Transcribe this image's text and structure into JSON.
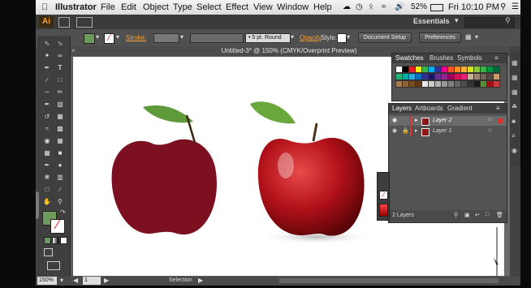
{
  "menubar": {
    "apple": "",
    "app_name": "Illustrator",
    "items": [
      "File",
      "Edit",
      "Object",
      "Type",
      "Select",
      "Effect",
      "View",
      "Window",
      "Help"
    ],
    "battery": "52%",
    "clock": "Fri 10:10 PM"
  },
  "appbar": {
    "logo": "Ai",
    "workspace": "Essentials"
  },
  "controlbar": {
    "stroke_label": "Stroke:",
    "brush": "5 pt. Round",
    "opacity_label": "Opacity",
    "style_label": "Style:",
    "doc_setup": "Document Setup",
    "preferences": "Preferences",
    "fill_color": "#6e9a5e"
  },
  "document": {
    "tab_title": "Untitled-3* @ 150% (CMYK/Overprint Preview)"
  },
  "swatches_panel": {
    "tabs": [
      "Swatches",
      "Brushes",
      "Symbols"
    ]
  },
  "layers_panel": {
    "tabs": [
      "Layers",
      "Artboards",
      "Gradient"
    ],
    "layers": [
      {
        "name": "Layer 2",
        "color": "#e03030"
      },
      {
        "name": "Layer 1",
        "color": "#e03030"
      }
    ],
    "count": "2 Layers"
  },
  "statusbar": {
    "zoom": "150%",
    "page": "1",
    "mode": "Selection"
  }
}
